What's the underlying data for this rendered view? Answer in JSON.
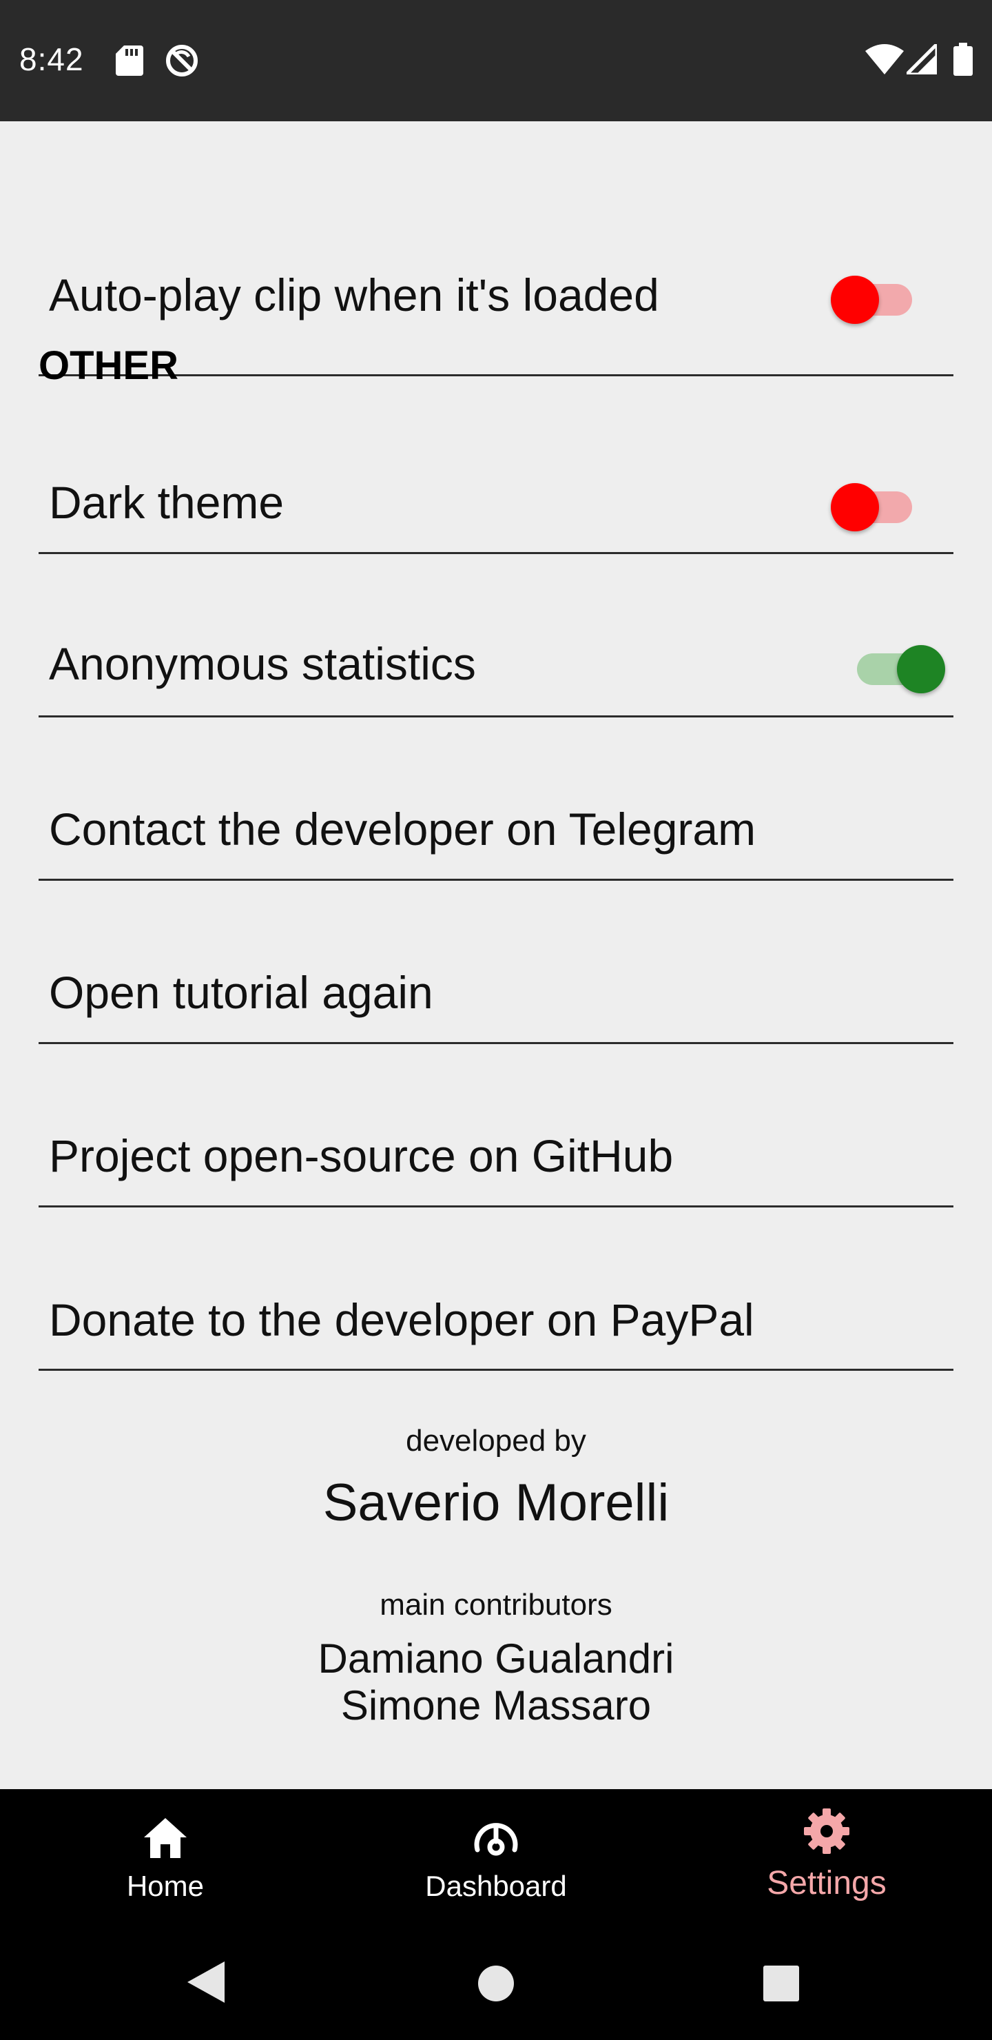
{
  "status_bar": {
    "time": "8:42",
    "left_icons": [
      "sd-card-icon",
      "no-sync-icon"
    ],
    "right_icons": [
      "wifi-icon",
      "signal-icon",
      "battery-icon"
    ]
  },
  "settings": {
    "autoplay": {
      "label": "Auto-play clip when it's loaded",
      "enabled": false
    },
    "section_other": "OTHER",
    "dark_theme": {
      "label": "Dark theme",
      "enabled": false
    },
    "anonymous_stats": {
      "label": "Anonymous statistics",
      "enabled": true
    },
    "telegram": {
      "label": "Contact the developer on Telegram"
    },
    "tutorial": {
      "label": "Open tutorial again"
    },
    "github": {
      "label": "Project open-source on GitHub"
    },
    "paypal": {
      "label": "Donate to the developer on PayPal"
    }
  },
  "credits": {
    "developed_by_label": "developed by",
    "developer_name": "Saverio Morelli",
    "contributors_label": "main contributors",
    "contributors": [
      "Damiano Gualandri",
      "Simone Massaro"
    ]
  },
  "bottom_nav": {
    "items": [
      {
        "label": "Home",
        "icon": "home-icon",
        "active": false
      },
      {
        "label": "Dashboard",
        "icon": "dashboard-icon",
        "active": false
      },
      {
        "label": "Settings",
        "icon": "settings-gear-icon",
        "active": true
      }
    ]
  },
  "colors": {
    "background": "#EEEEEE",
    "status_bar": "#2A2A2A",
    "toggle_off_thumb": "#FF0000",
    "toggle_off_track": "#F2A9AC",
    "toggle_on_thumb": "#1E8424",
    "toggle_on_track": "#A9D2A9",
    "nav_active": "#F4A7A9",
    "nav_background": "#000000"
  },
  "system_nav": [
    "back-icon",
    "home-circle-icon",
    "recents-icon"
  ]
}
